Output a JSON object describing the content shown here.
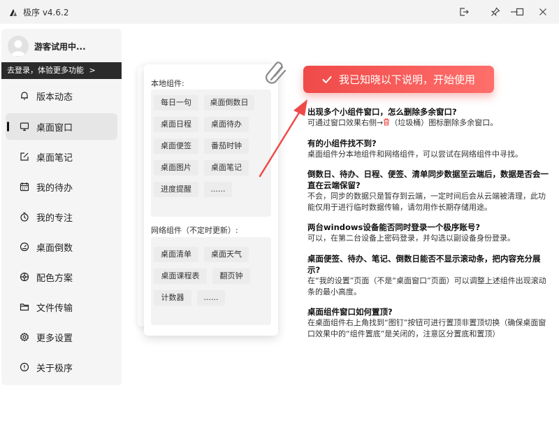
{
  "titlebar": {
    "title": "极序 v4.6.2",
    "buttons": [
      "exit-icon",
      "pin-icon",
      "minimize-icon",
      "maximize-icon",
      "close-icon"
    ]
  },
  "sidebar": {
    "user": {
      "name": "游客试用中..."
    },
    "login_prompt": "去登录，体验更多功能",
    "login_chevron": ">",
    "items": [
      {
        "label": "版本动态",
        "icon": "bell-icon"
      },
      {
        "label": "桌面窗口",
        "icon": "monitor-icon",
        "active": true
      },
      {
        "label": "桌面笔记",
        "icon": "note-edit-icon"
      },
      {
        "label": "我的待办",
        "icon": "calendar-icon"
      },
      {
        "label": "我的专注",
        "icon": "timer-icon"
      },
      {
        "label": "桌面倒数",
        "icon": "gauge-icon"
      },
      {
        "label": "配色方案",
        "icon": "palette-icon"
      },
      {
        "label": "文件传输",
        "icon": "folder-icon"
      },
      {
        "label": "更多设置",
        "icon": "gear-icon"
      },
      {
        "label": "关于极序",
        "icon": "info-icon"
      }
    ]
  },
  "widgets": {
    "local_title": "本地组件:",
    "local": [
      "每日一句",
      "桌面倒数日",
      "桌面日程",
      "桌面待办",
      "桌面便签",
      "番茄时钟",
      "桌面图片",
      "桌面笔记",
      "进度提醒",
      "......"
    ],
    "network_title": "网络组件（不定时更新）:",
    "network": [
      "桌面清单",
      "桌面天气",
      "桌面课程表",
      "翻页钟",
      "计数器",
      "......"
    ]
  },
  "cta": {
    "label": "我已知晓以下说明，开始使用"
  },
  "faq": [
    {
      "q": "出现多个小组件窗口，怎么删除多余窗口?",
      "a": [
        "可通过窗口效果右侧→",
        "（垃圾桶）图标删除多余窗口。"
      ]
    },
    {
      "q": "有的小组件找不到?",
      "a": [
        "桌面组件分本地组件和网络组件，可以尝试在网络组件中寻找。"
      ]
    },
    {
      "q": "倒数日、待办、日程、便签、清单同步数据至云端后，数据是否会一直在云端保留?",
      "a": [
        "不会，同步的数据只是暂存到云端，一定时间后会从云端被清理，此功能仅用于进行临时数据传输，请勿用作长期存储用途。"
      ]
    },
    {
      "q": "两台windows设备能否同时登录一个极序账号?",
      "a": [
        "可以，在第二台设备上密码登录，并勾选以副设备身份登录。"
      ]
    },
    {
      "q": "桌面便签、待办、笔记、倒数日能否不显示滚动条，把内容充分展示?",
      "a": [
        "在“我的设置”页面（不是“桌面窗口”页面）可以调整上述组件出现滚动条的最小高度。"
      ]
    },
    {
      "q": "桌面组件窗口如何置顶?",
      "a": [
        "在桌面组件右上角找到“图钉”按钮可进行置顶非置顶切换（确保桌面窗口效果中的“组件置底”是关闭的，注意区分置底和置顶）"
      ]
    }
  ],
  "colors": {
    "accent": "#ef4a49",
    "sidebar_bg": "#f5f5f5",
    "login_bar": "#2b2b2b"
  }
}
